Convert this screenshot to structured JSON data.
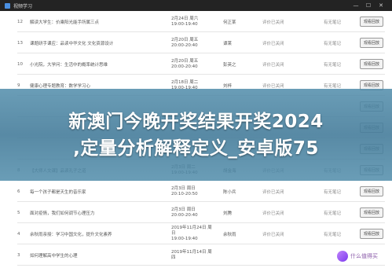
{
  "window": {
    "title": "视频学习"
  },
  "rows": [
    {
      "index": "12",
      "title": "解读大学生：价乘阳光能手所属三点",
      "date": "2月24日 周六",
      "time": "19:00-19:40",
      "teacher": "何正某",
      "status": "评价已关闭",
      "note": "有无笔记",
      "action": "观看回放"
    },
    {
      "index": "13",
      "title": "课题研手课应：品读中华文化 文化资源设计",
      "date": "2月20日 周五",
      "time": "20:00-20:40",
      "teacher": "谭莱",
      "status": "评价已关闭",
      "note": "有无笔记",
      "action": "观看回放"
    },
    {
      "index": "10",
      "title": "小光院，大学问：生活中的概率统计思维",
      "date": "2月20日 周五",
      "time": "20:00-20:40",
      "teacher": "彭英之",
      "status": "评价已关闭",
      "note": "有无笔记",
      "action": "观看回放"
    },
    {
      "index": "9",
      "title": "健康心理专题教育：数学学习心",
      "date": "2月18日 周二",
      "time": "19:00-19:40",
      "teacher": "刘梓",
      "status": "评价已关闭",
      "note": "有无笔记",
      "action": "观看回放"
    },
    {
      "index": "",
      "title": "",
      "date": "",
      "time": "",
      "teacher": "",
      "status": "",
      "note": "",
      "action": "观看回放"
    },
    {
      "index": "",
      "title": "",
      "date": "",
      "time": "",
      "teacher": "",
      "status": "",
      "note": "",
      "action": "观看回放"
    },
    {
      "index": "",
      "title": "",
      "date": "",
      "time": "",
      "teacher": "",
      "status": "",
      "note": "",
      "action": "观看回放"
    },
    {
      "index": "8",
      "title": "【大师人文课】品读孔子之道",
      "date": "2月3日 周二",
      "time": "19:00-19:40",
      "teacher": "胡金海",
      "status": "评价已关闭",
      "note": "有无笔记",
      "action": "观看回放"
    },
    {
      "index": "6",
      "title": "每一个孩子都是天生的音乐家",
      "date": "2月3日 周日",
      "time": "20:10-20:50",
      "teacher": "陈小兵",
      "status": "评价已关闭",
      "note": "有无笔记",
      "action": "观看回放"
    },
    {
      "index": "5",
      "title": "面对疫情，我们如何调节心理压力",
      "date": "2月3日 周日",
      "time": "20:00-20:40",
      "teacher": "刘腾",
      "status": "评价已关闭",
      "note": "有无笔记",
      "action": "观看回放"
    },
    {
      "index": "4",
      "title": "余秋雨亲授：学习中国文化，提升文化素养",
      "date": "2019年11月24日 周日",
      "time": "19:00-19:40",
      "teacher": "余秋雨",
      "status": "评价已关闭",
      "note": "有无笔记",
      "action": "观看回放"
    },
    {
      "index": "3",
      "title": "如何理解高中学生的心理",
      "date": "2019年11月14日 周四",
      "time": "",
      "teacher": "",
      "status": "",
      "note": "",
      "action": ""
    }
  ],
  "banner": {
    "line1": "新澳门今晚开奖结果开奖2024",
    "line2": ",定量分析解释定义_安卓版75"
  },
  "watermark": {
    "text": "什么值得买"
  }
}
